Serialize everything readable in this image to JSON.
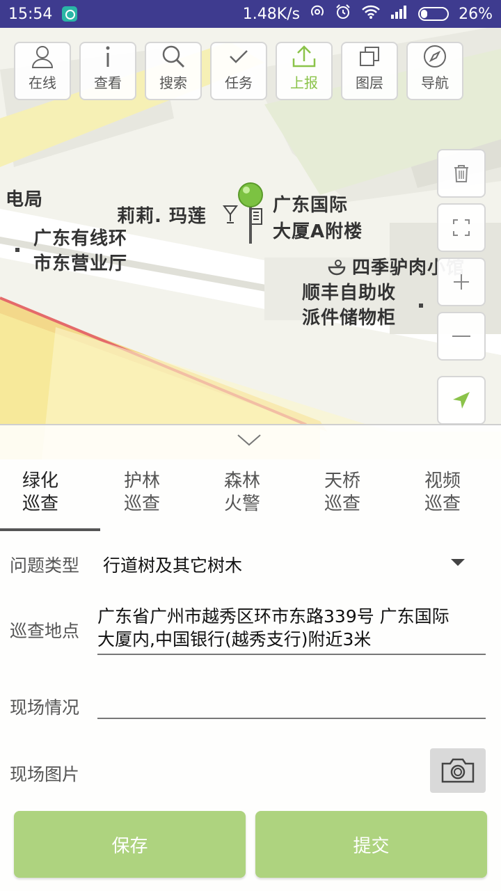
{
  "status_bar": {
    "time": "15:54",
    "network_speed": "1.48K/s",
    "battery": "26%",
    "battery_level": 0.26
  },
  "toolbar": {
    "buttons": [
      {
        "label": "在线",
        "icon": "user-icon"
      },
      {
        "label": "查看",
        "icon": "info-icon"
      },
      {
        "label": "搜索",
        "icon": "search-icon"
      },
      {
        "label": "任务",
        "icon": "check-icon"
      },
      {
        "label": "上报",
        "icon": "upload-icon",
        "active": true
      },
      {
        "label": "图层",
        "icon": "layers-icon"
      },
      {
        "label": "导航",
        "icon": "compass-icon"
      }
    ]
  },
  "map": {
    "labels": {
      "l1": "电局",
      "l2": "莉莉. 玛莲",
      "l3": "广东国际",
      "l4": "大厦A附楼",
      "l5": "广东有线环",
      "l6": "市东营业厅",
      "l7": "四季驴肉小馆",
      "l8": "顺丰自助收",
      "l9": "派件储物柜"
    },
    "accent_color": "#8bc34a"
  },
  "form": {
    "tabs": [
      {
        "line1": "绿化",
        "line2": "巡查",
        "active": true
      },
      {
        "line1": "护林",
        "line2": "巡查"
      },
      {
        "line1": "森林",
        "line2": "火警"
      },
      {
        "line1": "天桥",
        "line2": "巡查"
      },
      {
        "line1": "视频",
        "line2": "巡查"
      }
    ],
    "problem_type_label": "问题类型",
    "problem_type_value": "行道树及其它树木",
    "location_label": "巡查地点",
    "location_value_line1": "广东省广州市越秀区环市东路339号 广东国际",
    "location_value_line2": "大厦内,中国银行(越秀支行)附近3米",
    "situation_label": "现场情况",
    "situation_value": "",
    "photo_label": "现场图片",
    "save_label": "保存",
    "submit_label": "提交",
    "button_color": "#aed37f"
  }
}
